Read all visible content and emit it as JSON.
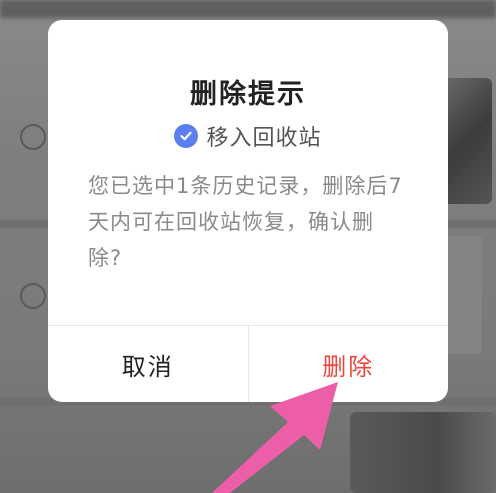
{
  "dialog": {
    "title": "删除提示",
    "move_option_label": "移入回收站",
    "message": "您已选中1条历史记录，删除后7天内可在回收站恢复，确认删除?",
    "cancel_label": "取消",
    "delete_label": "删除"
  },
  "colors": {
    "accent_check": "#5b7ff0",
    "delete_red": "#e8463c",
    "annotation_arrow": "#ec5fa8"
  },
  "icons": {
    "check": "check-circle-icon",
    "arrow": "pointer-arrow-icon"
  }
}
